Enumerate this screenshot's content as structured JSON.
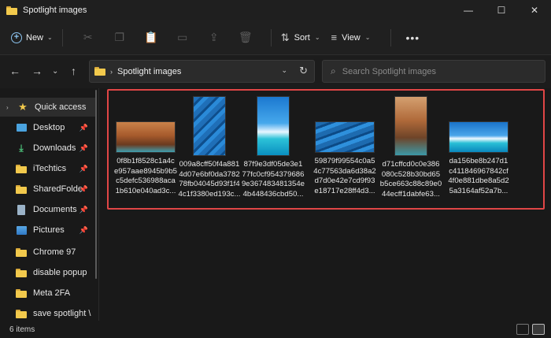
{
  "window": {
    "title": "Spotlight images",
    "controls": [
      "—",
      "☐",
      "✕"
    ]
  },
  "toolbar": {
    "new_label": "New",
    "sort_label": "Sort",
    "view_label": "View",
    "more_label": "•••",
    "disabled_icons": [
      "cut-icon",
      "copy-icon",
      "paste-icon",
      "rename-icon",
      "share-icon",
      "delete-icon"
    ]
  },
  "address": {
    "path": "Spotlight images"
  },
  "search": {
    "placeholder": "Search Spotlight images"
  },
  "sidebar": {
    "items": [
      {
        "label": "Quick access",
        "icon": "star-icon",
        "pinned": false
      },
      {
        "label": "Desktop",
        "icon": "desktop-icon",
        "pinned": true
      },
      {
        "label": "Downloads",
        "icon": "download-icon",
        "pinned": true
      },
      {
        "label": "iTechtics",
        "icon": "folder-icon",
        "pinned": true
      },
      {
        "label": "SharedFolde",
        "icon": "folder-icon",
        "pinned": true
      },
      {
        "label": "Documents",
        "icon": "documents-icon",
        "pinned": true
      },
      {
        "label": "Pictures",
        "icon": "pictures-icon",
        "pinned": true
      },
      {
        "label": "Chrome 97",
        "icon": "folder-icon",
        "pinned": false
      },
      {
        "label": "disable popup",
        "icon": "folder-icon",
        "pinned": false
      },
      {
        "label": "Meta 2FA",
        "icon": "folder-icon",
        "pinned": false
      },
      {
        "label": "save spotlight \\",
        "icon": "folder-icon",
        "pinned": false
      }
    ]
  },
  "files": [
    {
      "name_lines": [
        "0f8b1f8528c1a4c",
        "e957aae8945b9b5",
        "c5defc536988aca",
        "1b610e040ad3c..."
      ],
      "thumb": "canyon-landscape"
    },
    {
      "name_lines": [
        "009a8cff50f4a881",
        "4d07e6bf0da3782",
        "78fb04045d93f1f4",
        "4c1f3380ed193c..."
      ],
      "thumb": "blue-feathers-portrait"
    },
    {
      "name_lines": [
        "87f9e3df05de3e1",
        "77fc0cf954379686",
        "9e367483481354e",
        "4b448436cbd50..."
      ],
      "thumb": "ocean-sky-portrait"
    },
    {
      "name_lines": [
        "59879f99554c0a5",
        "4c77563da6d38a2",
        "d7d0e42e7cd9f93",
        "e18717e28ff4d3..."
      ],
      "thumb": "blue-feathers-landscape"
    },
    {
      "name_lines": [
        "d71cffcd0c0e386",
        "080c528b30bd65",
        "b5ce663c88c89e0",
        "44ecff1dabfe63..."
      ],
      "thumb": "canyon-portrait"
    },
    {
      "name_lines": [
        "da156be8b247d1",
        "c411846967842cf",
        "4f0e881dbe8a5d2",
        "5a3164af52a7b..."
      ],
      "thumb": "ocean-beach-landscape"
    }
  ],
  "status": {
    "item_count": "6 items"
  }
}
